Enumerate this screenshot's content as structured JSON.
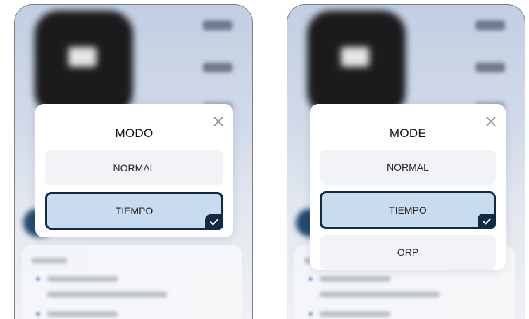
{
  "screens": [
    {
      "modal": {
        "title": "MODO",
        "options": [
          {
            "label": "NORMAL",
            "selected": false
          },
          {
            "label": "TIEMPO",
            "selected": true
          }
        ]
      }
    },
    {
      "modal": {
        "title": "MODE",
        "options": [
          {
            "label": "NORMAL",
            "selected": false
          },
          {
            "label": "TIEMPO",
            "selected": true
          },
          {
            "label": "ORP",
            "selected": false
          }
        ]
      }
    }
  ],
  "icons": {
    "close": "close-icon",
    "check": "check-icon"
  },
  "colors": {
    "selected_border": "#0e2c45",
    "selected_fill": "#c9dcef",
    "option_fill": "#f2f3f7"
  }
}
